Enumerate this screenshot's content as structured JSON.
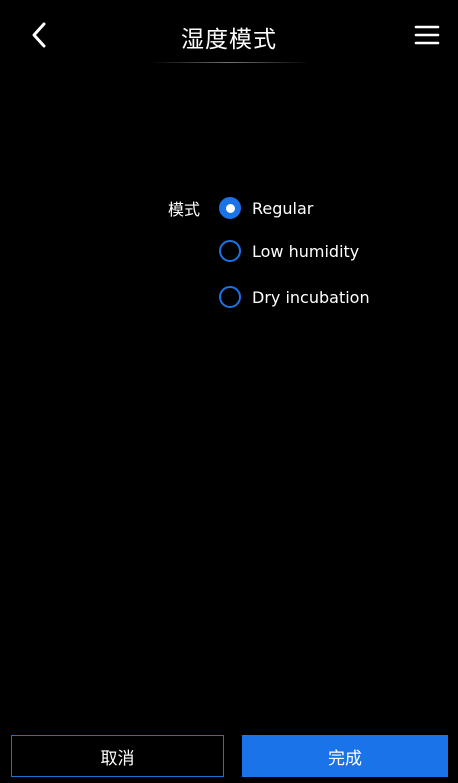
{
  "header": {
    "title": "湿度模式",
    "back_icon": "chevron-left-icon",
    "menu_icon": "hamburger-menu-icon"
  },
  "form": {
    "mode_label": "模式",
    "options": [
      {
        "label": "Regular",
        "checked": true
      },
      {
        "label": "Low humidity",
        "checked": false
      },
      {
        "label": "Dry incubation",
        "checked": false
      }
    ]
  },
  "footer": {
    "cancel_label": "取消",
    "done_label": "完成"
  },
  "colors": {
    "background": "#000000",
    "accent": "#1a73e8",
    "text": "#ffffff"
  }
}
